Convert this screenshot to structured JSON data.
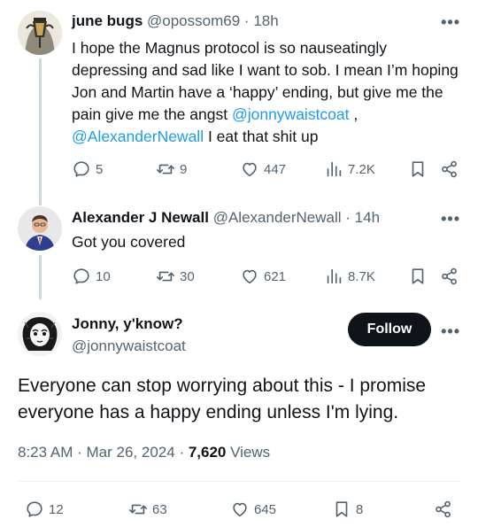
{
  "tweets": [
    {
      "name": "june bugs",
      "handle": "@opossom69",
      "sep": "·",
      "time": "18h",
      "text_before": "I hope the Magnus protocol is so nauseatingly depressing and sad like I want to sob. I mean I’m hoping Jon and Martin have a ‘happy’ ending, but give me the pain give me the angst ",
      "mention1": "@jonnywaistcoat",
      "text_mid": " , ",
      "mention2": "@AlexanderNewall",
      "text_after": " I eat that shit up",
      "replies": "5",
      "reposts": "9",
      "likes": "447",
      "views": "7.2K"
    },
    {
      "name": "Alexander J Newall",
      "handle": "@AlexanderNewall",
      "sep": "·",
      "time": "14h",
      "text": "Got you covered",
      "replies": "10",
      "reposts": "30",
      "likes": "621",
      "views": "8.7K"
    }
  ],
  "main": {
    "name": "Jonny, y'know?",
    "handle": "@jonnywaistcoat",
    "follow_label": "Follow",
    "text": "Everyone can stop worrying about this - I promise everyone has a happy ending unless I'm lying.",
    "time": "8:23 AM",
    "date": "Mar 26, 2024",
    "sep": "·",
    "views_count": "7,620",
    "views_label": "Views",
    "replies": "12",
    "reposts": "63",
    "likes": "645",
    "bookmarks": "8"
  },
  "more_glyph": "•••",
  "icons": [
    "reply-icon",
    "repost-icon",
    "like-icon",
    "views-icon",
    "bookmark-icon",
    "share-icon",
    "more-icon"
  ],
  "colors": {
    "accent": "#1d9bf0",
    "text": "#0f1419",
    "muted": "#536471",
    "follow_bg": "#0f1419"
  }
}
